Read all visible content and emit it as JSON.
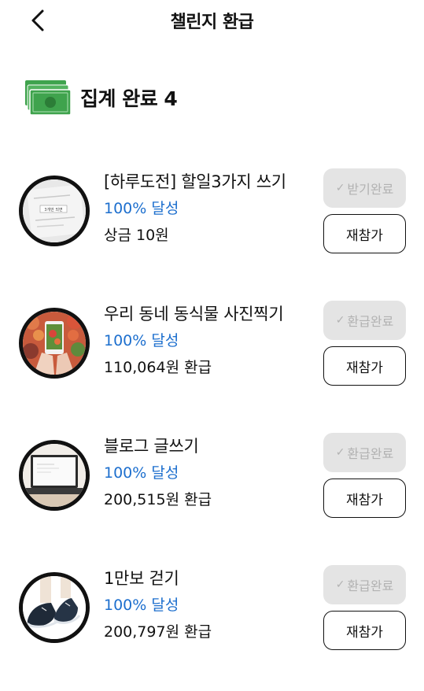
{
  "header": {
    "title": "챌린지 환급",
    "back_icon": "chevron-left-icon"
  },
  "summary": {
    "icon": "money-stack-icon",
    "title": "집계 완료 4",
    "color": "#3fa34d"
  },
  "colors": {
    "accent_blue": "#1d6fce",
    "done_bg": "#e4e4e4",
    "done_text": "#b2b2b2"
  },
  "challenges": [
    {
      "title": "[하루도전] 할일3가지 쓰기",
      "progress": "100% 달성",
      "reward": "상금 10원",
      "status_label": "받기완료",
      "status_icon": "check-icon",
      "action_label": "재참가",
      "thumbnail": "todo-note-photo",
      "thumb_caption": "3개만 되면"
    },
    {
      "title": "우리 동네 동식물 사진찍기",
      "progress": "100% 달성",
      "reward": "110,064원 환급",
      "status_label": "환급완료",
      "status_icon": "check-icon",
      "action_label": "재참가",
      "thumbnail": "flower-phone-photo"
    },
    {
      "title": "블로그 글쓰기",
      "progress": "100% 달성",
      "reward": "200,515원 환급",
      "status_label": "환급완료",
      "status_icon": "check-icon",
      "action_label": "재참가",
      "thumbnail": "laptop-photo"
    },
    {
      "title": "1만보 걷기",
      "progress": "100% 달성",
      "reward": "200,797원 환급",
      "status_label": "환급완료",
      "status_icon": "check-icon",
      "action_label": "재참가",
      "thumbnail": "sneakers-photo"
    }
  ]
}
